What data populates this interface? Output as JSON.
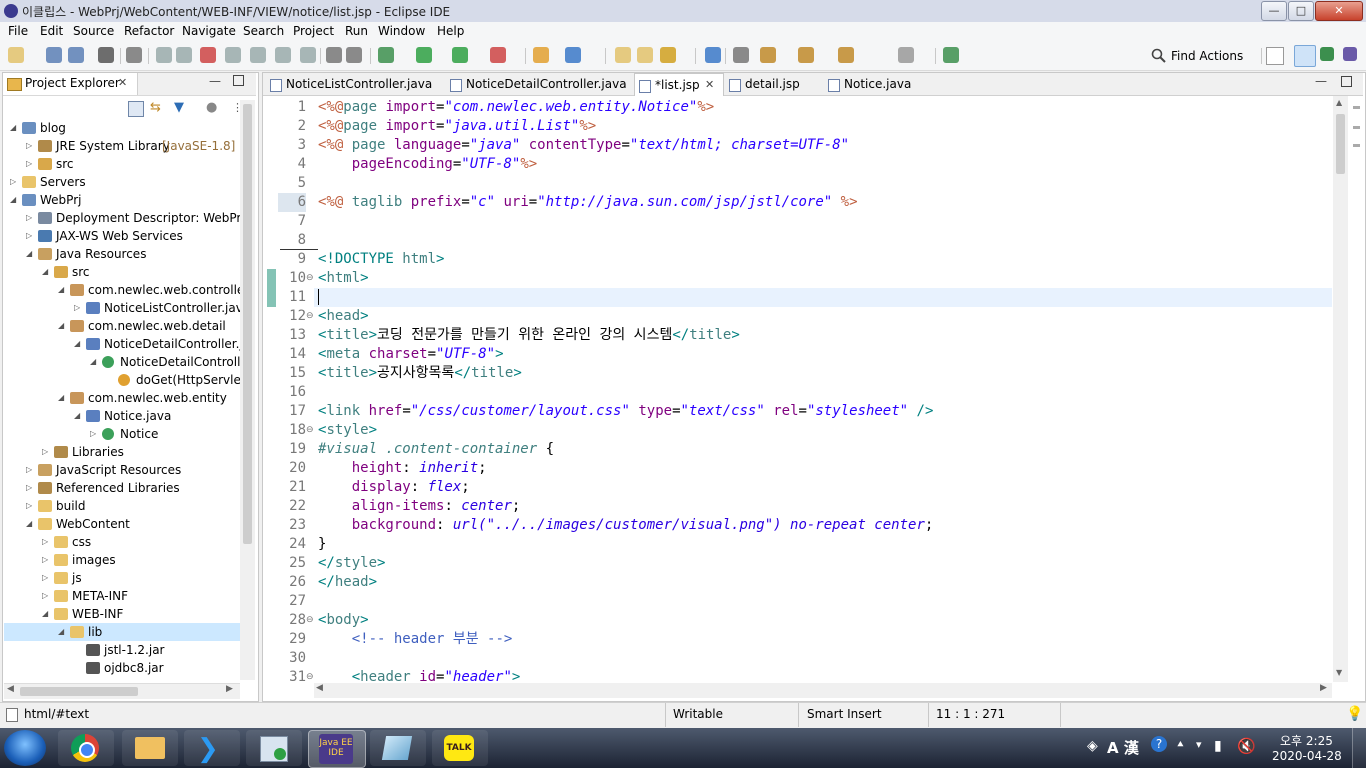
{
  "window": {
    "title": "이클립스 - WebPrj/WebContent/WEB-INF/VIEW/notice/list.jsp - Eclipse IDE",
    "minimize": "—",
    "maximize": "□",
    "close": "✕"
  },
  "menu": [
    "File",
    "Edit",
    "Source",
    "Refactor",
    "Navigate",
    "Search",
    "Project",
    "Run",
    "Window",
    "Help"
  ],
  "toolbar": {
    "find_actions_label": "Find Actions"
  },
  "project_explorer": {
    "title": "Project Explorer",
    "tree": [
      {
        "label": "blog",
        "level": 0,
        "icon": "project-icon",
        "expanded": true
      },
      {
        "label": "JRE System Library",
        "suffix": "[JavaSE-1.8]",
        "level": 1,
        "icon": "library-icon",
        "expanded": false
      },
      {
        "label": "src",
        "level": 1,
        "icon": "package-folder-icon",
        "expanded": false
      },
      {
        "label": "Servers",
        "level": 0,
        "icon": "folder-icon",
        "expanded": false
      },
      {
        "label": "WebPrj",
        "level": 0,
        "icon": "project-icon",
        "expanded": true
      },
      {
        "label": "Deployment Descriptor: WebPrj",
        "level": 1,
        "icon": "descriptor-icon",
        "expanded": false
      },
      {
        "label": "JAX-WS Web Services",
        "level": 1,
        "icon": "webservice-icon",
        "expanded": false
      },
      {
        "label": "Java Resources",
        "level": 1,
        "icon": "java-resources-icon",
        "expanded": true
      },
      {
        "label": "src",
        "level": 2,
        "icon": "package-folder-icon",
        "expanded": true
      },
      {
        "label": "com.newlec.web.controller",
        "level": 3,
        "icon": "package-icon",
        "expanded": true
      },
      {
        "label": "NoticeListController.java",
        "level": 4,
        "icon": "java-file-icon",
        "expanded": false
      },
      {
        "label": "com.newlec.web.detail",
        "level": 3,
        "icon": "package-icon",
        "expanded": true
      },
      {
        "label": "NoticeDetailController.ja",
        "level": 4,
        "icon": "java-file-icon",
        "expanded": true
      },
      {
        "label": "NoticeDetailControlle",
        "level": 5,
        "icon": "class-icon",
        "expanded": true
      },
      {
        "label": "doGet(HttpServletF",
        "level": 6,
        "icon": "method-icon",
        "expanded": null
      },
      {
        "label": "com.newlec.web.entity",
        "level": 3,
        "icon": "package-icon",
        "expanded": true
      },
      {
        "label": "Notice.java",
        "level": 4,
        "icon": "java-file-icon",
        "expanded": true
      },
      {
        "label": "Notice",
        "level": 5,
        "icon": "class-icon",
        "expanded": false
      },
      {
        "label": "Libraries",
        "level": 2,
        "icon": "library-icon",
        "expanded": false
      },
      {
        "label": "JavaScript Resources",
        "level": 1,
        "icon": "js-resources-icon",
        "expanded": false
      },
      {
        "label": "Referenced Libraries",
        "level": 1,
        "icon": "library-icon",
        "expanded": false
      },
      {
        "label": "build",
        "level": 1,
        "icon": "folder-icon",
        "expanded": false
      },
      {
        "label": "WebContent",
        "level": 1,
        "icon": "folder-icon",
        "expanded": true
      },
      {
        "label": "css",
        "level": 2,
        "icon": "folder-icon",
        "expanded": false
      },
      {
        "label": "images",
        "level": 2,
        "icon": "folder-icon",
        "expanded": false
      },
      {
        "label": "js",
        "level": 2,
        "icon": "folder-icon",
        "expanded": false
      },
      {
        "label": "META-INF",
        "level": 2,
        "icon": "folder-icon",
        "expanded": false
      },
      {
        "label": "WEB-INF",
        "level": 2,
        "icon": "folder-icon",
        "expanded": true
      },
      {
        "label": "lib",
        "level": 3,
        "icon": "folder-icon",
        "expanded": true,
        "selected": true
      },
      {
        "label": "jstl-1.2.jar",
        "level": 4,
        "icon": "jar-icon",
        "expanded": null
      },
      {
        "label": "ojdbc8.jar",
        "level": 4,
        "icon": "jar-icon",
        "expanded": null
      }
    ]
  },
  "editor_tabs": [
    {
      "label": "NoticeListController.java",
      "active": false,
      "icon": "java-file-icon"
    },
    {
      "label": "NoticeDetailController.java",
      "active": false,
      "icon": "java-file-icon"
    },
    {
      "label": "*list.jsp",
      "active": true,
      "icon": "jsp-file-icon",
      "close": "✕"
    },
    {
      "label": "detail.jsp",
      "active": false,
      "icon": "jsp-file-icon"
    },
    {
      "label": "Notice.java",
      "active": false,
      "icon": "java-file-icon"
    }
  ],
  "code_lines": [
    {
      "n": "1",
      "segs": [
        [
          "<%@",
          "#bf5f3f",
          ""
        ],
        [
          "page ",
          "#3f7f7f",
          ""
        ],
        [
          "import",
          "#7f007f",
          ""
        ],
        [
          "=",
          "#000",
          ""
        ],
        [
          "\"com.newlec.web.entity.Notice\"",
          "#2a00ff",
          "i"
        ],
        [
          "%>",
          "#bf5f3f",
          ""
        ]
      ]
    },
    {
      "n": "2",
      "segs": [
        [
          "<%@",
          "#bf5f3f",
          ""
        ],
        [
          "page ",
          "#3f7f7f",
          ""
        ],
        [
          "import",
          "#7f007f",
          ""
        ],
        [
          "=",
          "#000",
          ""
        ],
        [
          "\"java.util.List\"",
          "#2a00ff",
          "i"
        ],
        [
          "%>",
          "#bf5f3f",
          ""
        ]
      ]
    },
    {
      "n": "3",
      "segs": [
        [
          "<%@ ",
          "#bf5f3f",
          ""
        ],
        [
          "page ",
          "#3f7f7f",
          ""
        ],
        [
          "language",
          "#7f007f",
          ""
        ],
        [
          "=",
          "#000",
          ""
        ],
        [
          "\"java\"",
          "#2a00ff",
          "i"
        ],
        [
          " contentType",
          "#7f007f",
          ""
        ],
        [
          "=",
          "#000",
          ""
        ],
        [
          "\"text/html; charset=UTF-8\"",
          "#2a00ff",
          "i"
        ]
      ]
    },
    {
      "n": "4",
      "segs": [
        [
          "    pageEncoding",
          "#7f007f",
          ""
        ],
        [
          "=",
          "#000",
          ""
        ],
        [
          "\"UTF-8\"",
          "#2a00ff",
          "i"
        ],
        [
          "%>",
          "#bf5f3f",
          ""
        ]
      ]
    },
    {
      "n": "5",
      "segs": []
    },
    {
      "n": "6",
      "segs": [
        [
          "<%@ ",
          "#bf5f3f",
          ""
        ],
        [
          "taglib ",
          "#3f7f7f",
          ""
        ],
        [
          "prefix",
          "#7f007f",
          ""
        ],
        [
          "=",
          "#000",
          ""
        ],
        [
          "\"c\"",
          "#2a00ff",
          "i"
        ],
        [
          " uri",
          "#7f007f",
          ""
        ],
        [
          "=",
          "#000",
          ""
        ],
        [
          "\"http://java.sun.com/jsp/jstl/core\"",
          "#2a00ff",
          "i"
        ],
        [
          " %>",
          "#bf5f3f",
          ""
        ]
      ]
    },
    {
      "n": "7",
      "segs": []
    },
    {
      "n": "8",
      "segs": []
    },
    {
      "n": "9",
      "segs": [
        [
          "<!DOCTYPE ",
          "#008080",
          ""
        ],
        [
          "html",
          "#3f7f7f",
          ""
        ],
        [
          ">",
          "#008080",
          ""
        ]
      ]
    },
    {
      "n": "10",
      "fold": true,
      "segs": [
        [
          "<",
          "#008080",
          ""
        ],
        [
          "html",
          "#3f7f7f",
          ""
        ],
        [
          ">",
          "#008080",
          ""
        ]
      ]
    },
    {
      "n": "11",
      "segs": [],
      "current": true
    },
    {
      "n": "12",
      "fold": true,
      "segs": [
        [
          "<",
          "#008080",
          ""
        ],
        [
          "head",
          "#3f7f7f",
          ""
        ],
        [
          ">",
          "#008080",
          ""
        ]
      ]
    },
    {
      "n": "13",
      "segs": [
        [
          "<",
          "#008080",
          ""
        ],
        [
          "title",
          "#3f7f7f",
          ""
        ],
        [
          ">",
          "#008080",
          ""
        ],
        [
          "코딩 전문가를 만들기 위한 온라인 강의 시스템",
          "#000",
          ""
        ],
        [
          "</",
          "#008080",
          ""
        ],
        [
          "title",
          "#3f7f7f",
          ""
        ],
        [
          ">",
          "#008080",
          ""
        ]
      ]
    },
    {
      "n": "14",
      "segs": [
        [
          "<",
          "#008080",
          ""
        ],
        [
          "meta ",
          "#3f7f7f",
          ""
        ],
        [
          "charset",
          "#7f007f",
          ""
        ],
        [
          "=",
          "#000",
          ""
        ],
        [
          "\"UTF-8\"",
          "#2a00ff",
          "i"
        ],
        [
          ">",
          "#008080",
          ""
        ]
      ]
    },
    {
      "n": "15",
      "segs": [
        [
          "<",
          "#008080",
          ""
        ],
        [
          "title",
          "#3f7f7f",
          ""
        ],
        [
          ">",
          "#008080",
          ""
        ],
        [
          "공지사항목록",
          "#000",
          ""
        ],
        [
          "</",
          "#008080",
          ""
        ],
        [
          "title",
          "#3f7f7f",
          ""
        ],
        [
          ">",
          "#008080",
          ""
        ]
      ]
    },
    {
      "n": "16",
      "segs": []
    },
    {
      "n": "17",
      "segs": [
        [
          "<",
          "#008080",
          ""
        ],
        [
          "link ",
          "#3f7f7f",
          ""
        ],
        [
          "href",
          "#7f007f",
          ""
        ],
        [
          "=",
          "#000",
          ""
        ],
        [
          "\"/css/customer/layout.css\"",
          "#2a00ff",
          "i"
        ],
        [
          " type",
          "#7f007f",
          ""
        ],
        [
          "=",
          "#000",
          ""
        ],
        [
          "\"text/css\"",
          "#2a00ff",
          "i"
        ],
        [
          " rel",
          "#7f007f",
          ""
        ],
        [
          "=",
          "#000",
          ""
        ],
        [
          "\"stylesheet\"",
          "#2a00ff",
          "i"
        ],
        [
          " />",
          "#008080",
          ""
        ]
      ]
    },
    {
      "n": "18",
      "fold": true,
      "segs": [
        [
          "<",
          "#008080",
          ""
        ],
        [
          "style",
          "#3f7f7f",
          ""
        ],
        [
          ">",
          "#008080",
          ""
        ]
      ]
    },
    {
      "n": "19",
      "segs": [
        [
          "#visual .content-container",
          "#3f7f7f",
          "i"
        ],
        [
          " {",
          "#000",
          ""
        ]
      ]
    },
    {
      "n": "20",
      "segs": [
        [
          "    height",
          "#7f007f",
          ""
        ],
        [
          ": ",
          "#000",
          ""
        ],
        [
          "inherit",
          "#2a00e1",
          "i"
        ],
        [
          ";",
          "#000",
          ""
        ]
      ]
    },
    {
      "n": "21",
      "segs": [
        [
          "    display",
          "#7f007f",
          ""
        ],
        [
          ": ",
          "#000",
          ""
        ],
        [
          "flex",
          "#2a00e1",
          "i"
        ],
        [
          ";",
          "#000",
          ""
        ]
      ]
    },
    {
      "n": "22",
      "segs": [
        [
          "    align-items",
          "#7f007f",
          ""
        ],
        [
          ": ",
          "#000",
          ""
        ],
        [
          "center",
          "#2a00e1",
          "i"
        ],
        [
          ";",
          "#000",
          ""
        ]
      ]
    },
    {
      "n": "23",
      "segs": [
        [
          "    background",
          "#7f007f",
          ""
        ],
        [
          ": ",
          "#000",
          ""
        ],
        [
          "url(\"../../images/customer/visual.png\") no-repeat center",
          "#2a00e1",
          "i"
        ],
        [
          ";",
          "#000",
          ""
        ]
      ]
    },
    {
      "n": "24",
      "segs": [
        [
          "}",
          "#000",
          ""
        ]
      ]
    },
    {
      "n": "25",
      "segs": [
        [
          "</",
          "#008080",
          ""
        ],
        [
          "style",
          "#3f7f7f",
          ""
        ],
        [
          ">",
          "#008080",
          ""
        ]
      ]
    },
    {
      "n": "26",
      "segs": [
        [
          "</",
          "#008080",
          ""
        ],
        [
          "head",
          "#3f7f7f",
          ""
        ],
        [
          ">",
          "#008080",
          ""
        ]
      ]
    },
    {
      "n": "27",
      "segs": []
    },
    {
      "n": "28",
      "fold": true,
      "segs": [
        [
          "<",
          "#008080",
          ""
        ],
        [
          "body",
          "#3f7f7f",
          ""
        ],
        [
          ">",
          "#008080",
          ""
        ]
      ]
    },
    {
      "n": "29",
      "segs": [
        [
          "    <!-- header 부분 -->",
          "#3f5fbf",
          ""
        ]
      ]
    },
    {
      "n": "30",
      "segs": []
    },
    {
      "n": "31",
      "fold": true,
      "segs": [
        [
          "    <",
          "#008080",
          ""
        ],
        [
          "header ",
          "#3f7f7f",
          ""
        ],
        [
          "id",
          "#7f007f",
          ""
        ],
        [
          "=",
          "#000",
          ""
        ],
        [
          "\"header\"",
          "#2a00ff",
          "i"
        ],
        [
          ">",
          "#008080",
          ""
        ]
      ]
    }
  ],
  "status": {
    "path": "html/#text",
    "writable": "Writable",
    "insert_mode": "Smart Insert",
    "cursor": "11 : 1 : 271"
  },
  "taskbar": {
    "clock_time": "오후 2:25",
    "clock_date": "2020-04-28",
    "ime": "A 漢",
    "apps": [
      "chrome-icon",
      "explorer-icon",
      "vscode-icon",
      "media-icon",
      "eclipse-icon",
      "notepad-icon",
      "kakaotalk-icon"
    ],
    "eclipse_label": "Java EE IDE",
    "talk_label": "TALK"
  },
  "colors": {
    "accent_selected": "#cce8ff",
    "current_line": "#e8f2fe",
    "change_marker": "#6fb8a8"
  }
}
